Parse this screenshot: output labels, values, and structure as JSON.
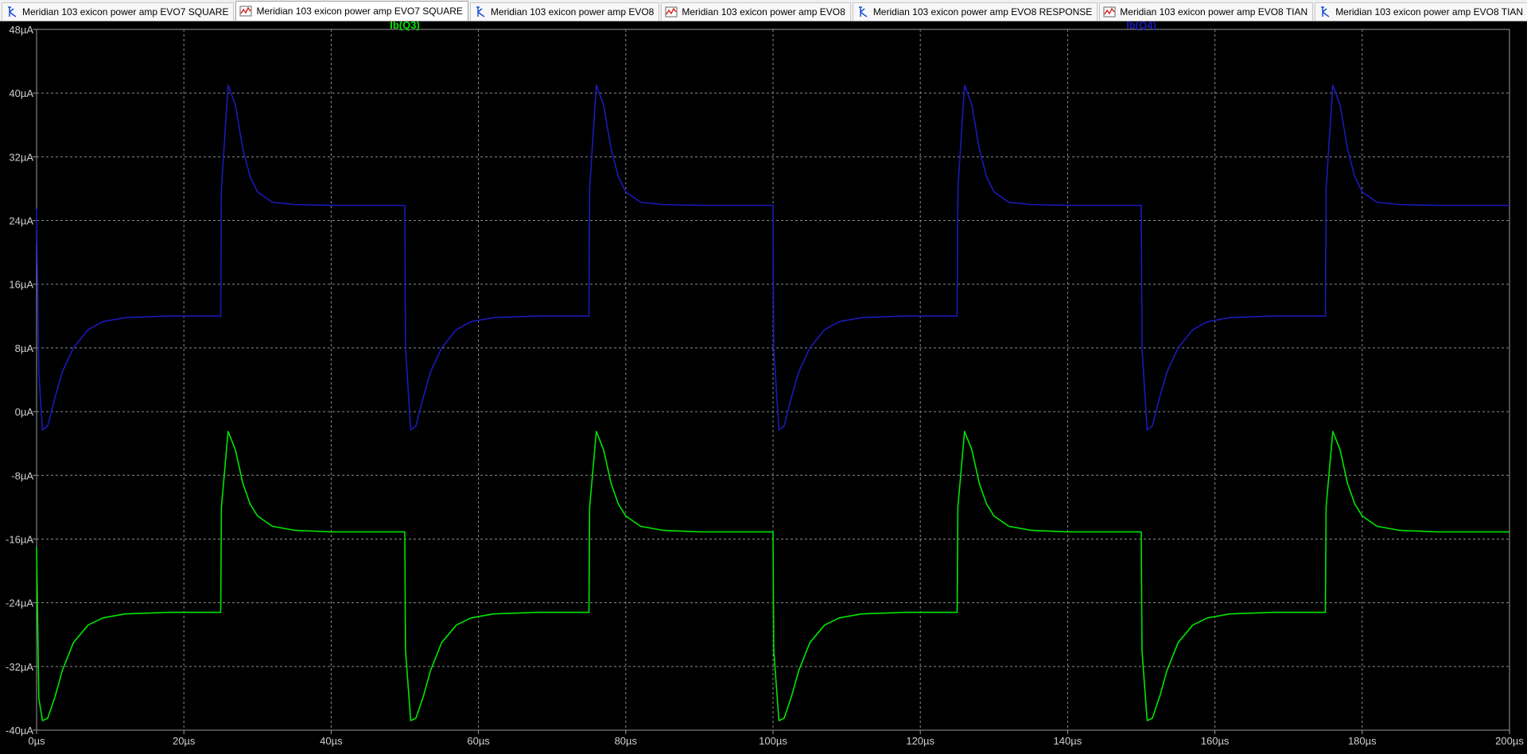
{
  "tabs": [
    {
      "label": "Meridian 103 exicon power amp EVO7 SQUARE",
      "icon": "schematic-icon",
      "active": false
    },
    {
      "label": "Meridian 103 exicon power amp EVO7 SQUARE",
      "icon": "waveform-icon",
      "active": true
    },
    {
      "label": "Meridian 103 exicon power amp EVO8",
      "icon": "schematic-icon",
      "active": false
    },
    {
      "label": "Meridian 103 exicon power amp EVO8",
      "icon": "waveform-icon",
      "active": false
    },
    {
      "label": "Meridian 103 exicon power amp EVO8 RESPONSE",
      "icon": "schematic-icon",
      "active": false
    },
    {
      "label": "Meridian 103 exicon power amp EVO8 TIAN",
      "icon": "waveform-icon",
      "active": false
    },
    {
      "label": "Meridian 103 exicon power amp EVO8 TIAN",
      "icon": "schematic-icon",
      "active": false
    }
  ],
  "colors": {
    "background": "#000000",
    "grid": "#8a8a8a",
    "tick_text": "#cfcfcf",
    "series_q3": "#00e600",
    "series_q4": "#1a1ab8",
    "schematic_icon": "#1a4fd6",
    "waveform_icon": "#d42a2a"
  },
  "chart_data": {
    "type": "line",
    "title": "",
    "xlabel": "",
    "ylabel": "",
    "x_unit": "µs",
    "y_unit": "µA",
    "xlim": [
      0,
      200
    ],
    "ylim": [
      -40,
      48
    ],
    "x_ticks": [
      0,
      20,
      40,
      60,
      80,
      100,
      120,
      140,
      160,
      180,
      200
    ],
    "y_ticks": [
      48,
      40,
      32,
      24,
      16,
      8,
      0,
      -8,
      -16,
      -24,
      -32,
      -40
    ],
    "x_tick_labels": [
      "0µs",
      "20µs",
      "40µs",
      "60µs",
      "80µs",
      "100µs",
      "120µs",
      "140µs",
      "160µs",
      "180µs",
      "200µs"
    ],
    "y_tick_labels": [
      "48µA",
      "40µA",
      "32µA",
      "24µA",
      "16µA",
      "8µA",
      "0µA",
      "-8µA",
      "-16µA",
      "-24µA",
      "-32µA",
      "-40µA"
    ],
    "grid": true,
    "legend": "top",
    "period_us": 50,
    "series": [
      {
        "name": "Ib(Q3)",
        "color_key": "series_q3",
        "x": [
          0,
          0.3,
          0.8,
          1.5,
          2.5,
          3.5,
          5,
          7,
          9,
          12,
          18,
          25,
          25.1,
          26,
          27,
          28,
          29,
          30,
          32,
          35,
          40,
          45,
          50,
          50.1,
          50.8,
          51.5,
          52.5,
          53.5,
          55,
          57,
          59,
          62,
          68,
          75,
          75.1,
          76,
          77,
          78,
          79,
          80,
          82,
          85,
          90,
          95,
          100,
          100.1,
          100.8,
          101.5,
          102.5,
          103.5,
          105,
          107,
          109,
          112,
          118,
          125,
          125.1,
          126,
          127,
          128,
          129,
          130,
          132,
          135,
          140,
          145,
          150,
          150.1,
          150.8,
          151.5,
          152.5,
          153.5,
          155,
          157,
          159,
          162,
          168,
          175,
          175.1,
          176,
          177,
          178,
          179,
          180,
          182,
          185,
          190,
          195,
          200
        ],
        "y": [
          -17,
          -36,
          -38.8,
          -38.5,
          -35.8,
          -32.5,
          -29,
          -26.8,
          -25.9,
          -25.4,
          -25.2,
          -25.2,
          -12,
          -2.5,
          -4.8,
          -9,
          -11.6,
          -13.1,
          -14.4,
          -14.9,
          -15.1,
          -15.1,
          -15.1,
          -30,
          -38.8,
          -38.5,
          -35.8,
          -32.5,
          -29,
          -26.8,
          -25.9,
          -25.4,
          -25.2,
          -25.2,
          -12,
          -2.5,
          -4.8,
          -9,
          -11.6,
          -13.1,
          -14.4,
          -14.9,
          -15.1,
          -15.1,
          -15.1,
          -30,
          -38.8,
          -38.5,
          -35.8,
          -32.5,
          -29,
          -26.8,
          -25.9,
          -25.4,
          -25.2,
          -25.2,
          -12,
          -2.5,
          -4.8,
          -9,
          -11.6,
          -13.1,
          -14.4,
          -14.9,
          -15.1,
          -15.1,
          -15.1,
          -30,
          -38.8,
          -38.5,
          -35.8,
          -32.5,
          -29,
          -26.8,
          -25.9,
          -25.4,
          -25.2,
          -25.2,
          -12,
          -2.5,
          -4.8,
          -9,
          -11.6,
          -13.1,
          -14.4,
          -14.9,
          -15.1,
          -15.1,
          -15.1
        ]
      },
      {
        "name": "Ib(Q4)",
        "color_key": "series_q4",
        "x": [
          0,
          0.3,
          0.8,
          1.5,
          2.5,
          3.5,
          5,
          7,
          9,
          12,
          18,
          25,
          25.1,
          26,
          27,
          28,
          29,
          30,
          32,
          35,
          40,
          45,
          50,
          50.1,
          50.8,
          51.5,
          52.5,
          53.5,
          55,
          57,
          59,
          62,
          68,
          75,
          75.1,
          76,
          77,
          78,
          79,
          80,
          82,
          85,
          90,
          95,
          100,
          100.1,
          100.8,
          101.5,
          102.5,
          103.5,
          105,
          107,
          109,
          112,
          118,
          125,
          125.1,
          126,
          127,
          128,
          129,
          130,
          132,
          135,
          140,
          145,
          150,
          150.1,
          150.8,
          151.5,
          152.5,
          153.5,
          155,
          157,
          159,
          162,
          168,
          175,
          175.1,
          176,
          177,
          178,
          179,
          180,
          182,
          185,
          190,
          195,
          200
        ],
        "y": [
          25.5,
          5,
          -2.3,
          -1.8,
          1.8,
          5,
          8,
          10.3,
          11.3,
          11.8,
          12,
          12,
          28,
          41,
          38.5,
          33,
          29.5,
          27.6,
          26.3,
          26,
          25.9,
          25.9,
          25.9,
          8,
          -2.3,
          -1.8,
          1.8,
          5,
          8,
          10.3,
          11.3,
          11.8,
          12,
          12,
          28,
          41,
          38.5,
          33,
          29.5,
          27.6,
          26.3,
          26,
          25.9,
          25.9,
          25.9,
          8,
          -2.3,
          -1.8,
          1.8,
          5,
          8,
          10.3,
          11.3,
          11.8,
          12,
          12,
          28,
          41,
          38.5,
          33,
          29.5,
          27.6,
          26.3,
          26,
          25.9,
          25.9,
          25.9,
          8,
          -2.3,
          -1.8,
          1.8,
          5,
          8,
          10.3,
          11.3,
          11.8,
          12,
          12,
          28,
          41,
          38.5,
          33,
          29.5,
          27.6,
          26.3,
          26,
          25.9,
          25.9,
          25.9
        ]
      }
    ]
  }
}
